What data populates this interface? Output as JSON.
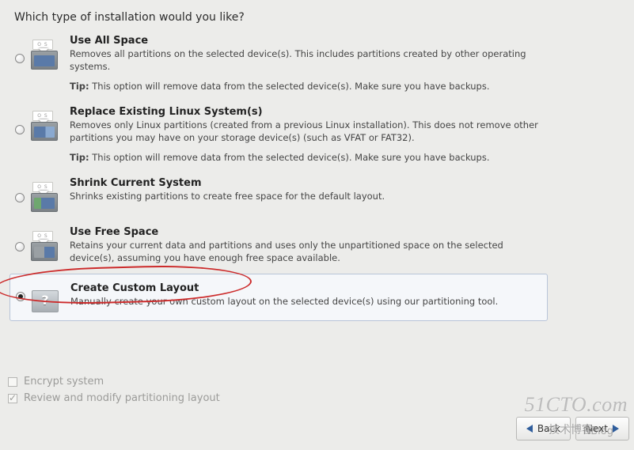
{
  "question": "Which type of installation would you like?",
  "options": [
    {
      "title": "Use All Space",
      "desc": "Removes all partitions on the selected device(s).  This includes partitions created by other operating systems.",
      "tip_label": "Tip:",
      "tip": " This option will remove data from the selected device(s).  Make sure you have backups."
    },
    {
      "title": "Replace Existing Linux System(s)",
      "desc": "Removes only Linux partitions (created from a previous Linux installation).  This does not remove other partitions you may have on your storage device(s) (such as VFAT or FAT32).",
      "tip_label": "Tip:",
      "tip": " This option will remove data from the selected device(s).  Make sure you have backups."
    },
    {
      "title": "Shrink Current System",
      "desc": "Shrinks existing partitions to create free space for the default layout."
    },
    {
      "title": "Use Free Space",
      "desc": "Retains your current data and partitions and uses only the unpartitioned space on the selected device(s), assuming you have enough free space available."
    },
    {
      "title": "Create Custom Layout",
      "desc": "Manually create your own custom layout on the selected device(s) using our partitioning tool."
    }
  ],
  "selected_index": 4,
  "checks": {
    "encrypt": {
      "label": "Encrypt system",
      "checked": false
    },
    "review": {
      "label": "Review and modify partitioning layout",
      "checked": true
    }
  },
  "nav": {
    "back": "Back",
    "next": "Next"
  },
  "watermarks": {
    "site": "51CTO.com",
    "sub": "技术博客",
    "user": "NBlog"
  }
}
